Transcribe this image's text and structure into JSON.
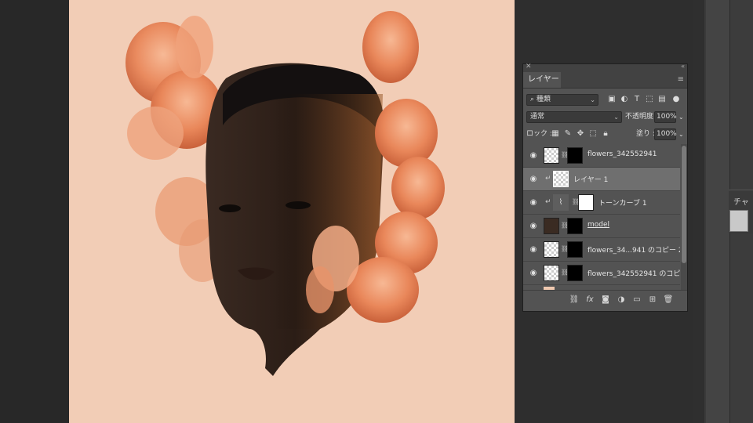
{
  "panel": {
    "tab_label": "レイヤー",
    "filter_kind_label": "種類",
    "blend_mode": "通常",
    "opacity_label": "不透明度 :",
    "opacity_value": "100%",
    "lock_label": "ロック :",
    "fill_label": "塗り :",
    "fill_value": "100%"
  },
  "layers": [
    {
      "name": "flowers_342552941",
      "visible": true,
      "selected": false,
      "underline": false
    },
    {
      "name": "レイヤー 1",
      "visible": true,
      "selected": true,
      "underline": false
    },
    {
      "name": "トーンカーブ 1",
      "visible": true,
      "selected": false,
      "underline": false
    },
    {
      "name": "model",
      "visible": true,
      "selected": false,
      "underline": true
    },
    {
      "name": "flowers_34...941 のコピー 2",
      "visible": true,
      "selected": false,
      "underline": false
    },
    {
      "name": "flowers_342552941 のコピー",
      "visible": true,
      "selected": false,
      "underline": false
    }
  ],
  "dock": {
    "channels_tab_label": "チャ"
  },
  "colors": {
    "canvas_bg": "#f2cdb6",
    "panel_bg": "#535353",
    "selected_row": "#6f6f6f",
    "flower_orange": "#e8875a"
  },
  "icons": [
    "eye-icon",
    "link-icon",
    "search-icon",
    "lock-icon",
    "fx-icon",
    "trash-icon"
  ]
}
